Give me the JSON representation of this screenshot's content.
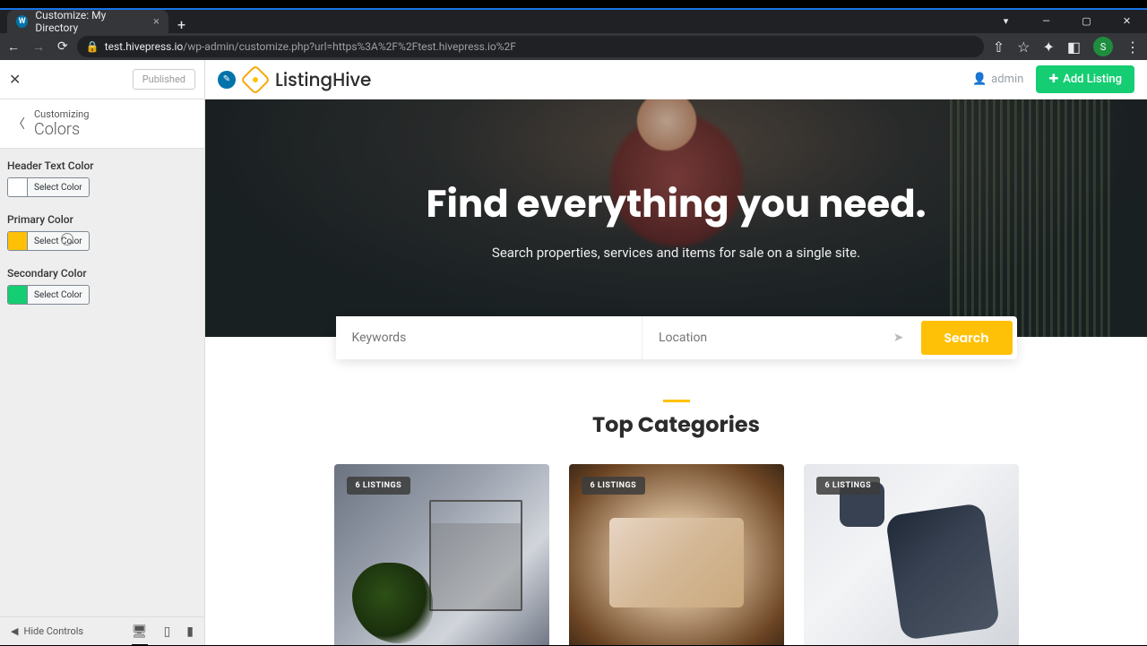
{
  "browser": {
    "tab_title": "Customize: My Directory",
    "url_host": "test.hivepress.io",
    "url_path": "/wp-admin/customize.php?url=https%3A%2F%2Ftest.hivepress.io%2F",
    "avatar_letter": "S"
  },
  "customizer": {
    "published_label": "Published",
    "crumb_sub": "Customizing",
    "crumb_main": "Colors",
    "controls": [
      {
        "label": "Header Text Color",
        "button": "Select Color",
        "swatch": "white"
      },
      {
        "label": "Primary Color",
        "button": "Select Color",
        "swatch": "yellow"
      },
      {
        "label": "Secondary Color",
        "button": "Select Color",
        "swatch": "green"
      }
    ],
    "hide_controls": "Hide Controls"
  },
  "site": {
    "name": "ListingHive",
    "admin_user": "admin",
    "add_listing": "Add Listing",
    "hero_title": "Find everything you need.",
    "hero_sub": "Search properties, services and items for sale on a single site.",
    "keywords_ph": "Keywords",
    "location_ph": "Location",
    "search_btn": "Search",
    "section_title": "Top Categories",
    "cat_badges": [
      "6 LISTINGS",
      "6 LISTINGS",
      "6 LISTINGS"
    ]
  }
}
